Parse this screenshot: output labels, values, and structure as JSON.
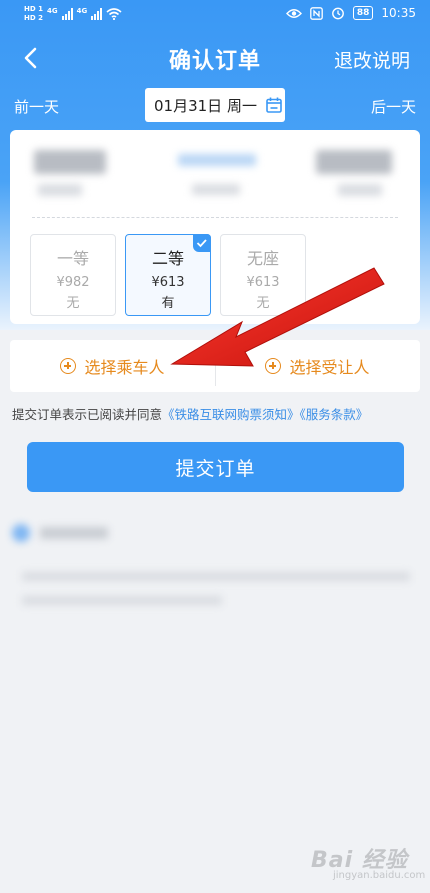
{
  "status_bar": {
    "hd_top": "HD 1",
    "hd_bottom": "HD 2",
    "net1": "4G",
    "net2": "4G",
    "battery": "88",
    "time": "10:35"
  },
  "nav": {
    "title": "确认订单",
    "right_label": "退改说明"
  },
  "date_bar": {
    "prev_label": "前一天",
    "date": "01月31日 周一",
    "next_label": "后一天"
  },
  "seats": [
    {
      "name": "一等",
      "price": "¥982",
      "stock": "无",
      "selected": false
    },
    {
      "name": "二等",
      "price": "¥613",
      "stock": "有",
      "selected": true
    },
    {
      "name": "无座",
      "price": "¥613",
      "stock": "无",
      "selected": false
    }
  ],
  "pick": {
    "passenger_label": "选择乘车人",
    "beneficiary_label": "选择受让人"
  },
  "agreement": {
    "prefix": "提交订单表示已阅读并同意",
    "link1": "《铁路互联网购票须知》",
    "link2": "《服务条款》"
  },
  "submit_label": "提交订单",
  "watermark": {
    "text": "Bai 经验",
    "sub": "jingyan.baidu.com"
  },
  "colors": {
    "primary": "#3a98f5",
    "accent": "#e68a1e",
    "arrow": "#e0201b"
  }
}
